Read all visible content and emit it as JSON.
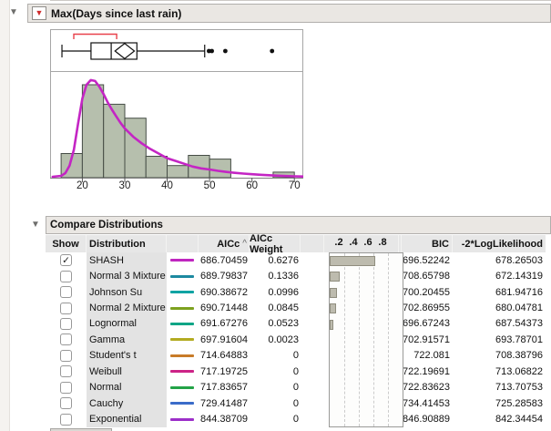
{
  "outline": {
    "distribution_title": "Max(Days since last rain)",
    "compare_title": "Compare Distributions"
  },
  "icons": {
    "disclosure": "▼",
    "red_triangle": "▼",
    "checkmark": "✓"
  },
  "chart_data": [
    {
      "type": "bar",
      "role": "histogram",
      "title": "Max(Days since last rain) histogram with SHASH fit",
      "x_range": [
        12.4,
        72.1
      ],
      "bin_start": 15,
      "bin_width": 5,
      "bin_heights": [
        0.26,
        1.0,
        0.79,
        0.64,
        0.23,
        0.13,
        0.24,
        0.2,
        0,
        0,
        0.06
      ],
      "x_ticks": [
        "20",
        "30",
        "40",
        "50",
        "60",
        "70"
      ],
      "bar_fill": "#b6bfad",
      "bar_stroke": "#454c45",
      "fit_curve": {
        "name": "SHASH fit",
        "color": "#c425c4",
        "points": [
          [
            13,
            0.01
          ],
          [
            15,
            0.02
          ],
          [
            16,
            0.05
          ],
          [
            17,
            0.13
          ],
          [
            18,
            0.3
          ],
          [
            19,
            0.58
          ],
          [
            20,
            0.85
          ],
          [
            21,
            1.0
          ],
          [
            22,
            1.05
          ],
          [
            23,
            1.04
          ],
          [
            24,
            0.98
          ],
          [
            25,
            0.9
          ],
          [
            26,
            0.81
          ],
          [
            27,
            0.73
          ],
          [
            28,
            0.66
          ],
          [
            29,
            0.59
          ],
          [
            30,
            0.53
          ],
          [
            32,
            0.44
          ],
          [
            34,
            0.37
          ],
          [
            36,
            0.31
          ],
          [
            38,
            0.26
          ],
          [
            40,
            0.21
          ],
          [
            42,
            0.18
          ],
          [
            44,
            0.15
          ],
          [
            46,
            0.12
          ],
          [
            48,
            0.1
          ],
          [
            50,
            0.088
          ],
          [
            52,
            0.074
          ],
          [
            54,
            0.062
          ],
          [
            56,
            0.052
          ],
          [
            58,
            0.044
          ],
          [
            60,
            0.037
          ],
          [
            62,
            0.031
          ],
          [
            64,
            0.026
          ],
          [
            66,
            0.022
          ],
          [
            68,
            0.018
          ],
          [
            70,
            0.015
          ],
          [
            72,
            0.013
          ]
        ]
      }
    },
    {
      "type": "boxplot",
      "role": "outlier-boxplot",
      "whisker_low": 15,
      "q1": 21.9,
      "median": 26.7,
      "q3": 32.8,
      "whisker_high": 48.9,
      "mean_diamond": {
        "left": 27.6,
        "center": 29.9,
        "right": 32.2
      },
      "outliers": [
        49.9,
        50.6,
        53.8,
        64.9
      ],
      "shortest_half": [
        17.8,
        28.0
      ],
      "shortest_half_color": "#e8414b"
    }
  ],
  "table": {
    "columns": {
      "show": "Show",
      "distribution": "Distribution",
      "aicc": "AICc",
      "aicc_sort": "^",
      "weight": "AICc Weight",
      "bic": "BIC",
      "loglik": "-2*LogLikelihood"
    },
    "weight_axis_ticks": [
      ".2",
      ".4",
      ".6",
      ".8"
    ],
    "rows": [
      {
        "show": true,
        "name": "SHASH",
        "color": "#bf26bf",
        "aicc": "686.70459",
        "weight": "0.6276",
        "bic": "696.52242",
        "loglik": "678.26503"
      },
      {
        "show": false,
        "name": "Normal 3 Mixture",
        "color": "#1d89a0",
        "aicc": "689.79837",
        "weight": "0.1336",
        "bic": "708.65798",
        "loglik": "672.14319"
      },
      {
        "show": false,
        "name": "Johnson Su",
        "color": "#0fa3a3",
        "aicc": "690.38672",
        "weight": "0.0996",
        "bic": "700.20455",
        "loglik": "681.94716"
      },
      {
        "show": false,
        "name": "Normal 2 Mixture",
        "color": "#7da11f",
        "aicc": "690.71448",
        "weight": "0.0845",
        "bic": "702.86955",
        "loglik": "680.04781"
      },
      {
        "show": false,
        "name": "Lognormal",
        "color": "#0fa586",
        "aicc": "691.67276",
        "weight": "0.0523",
        "bic": "696.67243",
        "loglik": "687.54373"
      },
      {
        "show": false,
        "name": "Gamma",
        "color": "#b3ab21",
        "aicc": "697.91604",
        "weight": "0.0023",
        "bic": "702.91571",
        "loglik": "693.78701"
      },
      {
        "show": false,
        "name": "Student's t",
        "color": "#c87b28",
        "aicc": "714.64883",
        "weight": "0",
        "bic": "722.081",
        "loglik": "708.38796"
      },
      {
        "show": false,
        "name": "Weibull",
        "color": "#cc2387",
        "aicc": "717.19725",
        "weight": "0",
        "bic": "722.19691",
        "loglik": "713.06822"
      },
      {
        "show": false,
        "name": "Normal",
        "color": "#23a347",
        "aicc": "717.83657",
        "weight": "0",
        "bic": "722.83623",
        "loglik": "713.70753"
      },
      {
        "show": false,
        "name": "Cauchy",
        "color": "#3a6cc9",
        "aicc": "729.41487",
        "weight": "0",
        "bic": "734.41453",
        "loglik": "725.28583"
      },
      {
        "show": false,
        "name": "Exponential",
        "color": "#9c2fc9",
        "aicc": "844.38709",
        "weight": "0",
        "bic": "846.90889",
        "loglik": "842.34454"
      }
    ]
  }
}
